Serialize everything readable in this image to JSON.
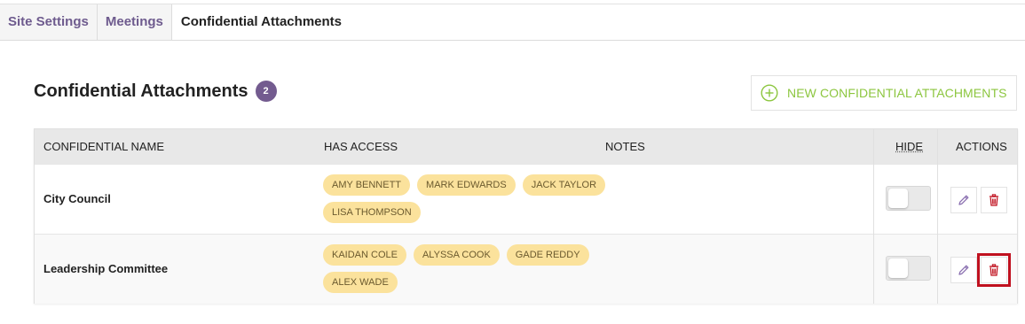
{
  "tabs": [
    {
      "label": "Site Settings",
      "active": false
    },
    {
      "label": "Meetings",
      "active": false
    },
    {
      "label": "Confidential Attachments",
      "active": true
    }
  ],
  "page": {
    "title": "Confidential Attachments",
    "count": "2",
    "new_button_label": "NEW CONFIDENTIAL ATTACHMENTS"
  },
  "table": {
    "headers": {
      "name": "CONFIDENTIAL NAME",
      "access": "HAS ACCESS",
      "notes": "NOTES",
      "hide": "HIDE",
      "actions": "ACTIONS"
    },
    "rows": [
      {
        "name": "City Council",
        "access": [
          "AMY BENNETT",
          "MARK EDWARDS",
          "JACK TAYLOR",
          "LISA THOMPSON"
        ],
        "notes": "",
        "hidden": false
      },
      {
        "name": "Leadership Committee",
        "access": [
          "KAIDAN COLE",
          "ALYSSA COOK",
          "GADE REDDY",
          "ALEX WADE"
        ],
        "notes": "",
        "hidden": false
      }
    ]
  },
  "colors": {
    "accent_purple": "#735b8f",
    "new_button_green": "#8cc63f",
    "chip_yellow": "#fbe29c",
    "delete_red": "#c0111f",
    "highlight_red": "#c0111f"
  },
  "icons": {
    "new": "plus-circle-icon",
    "edit": "pencil-icon",
    "delete": "trash-icon"
  }
}
